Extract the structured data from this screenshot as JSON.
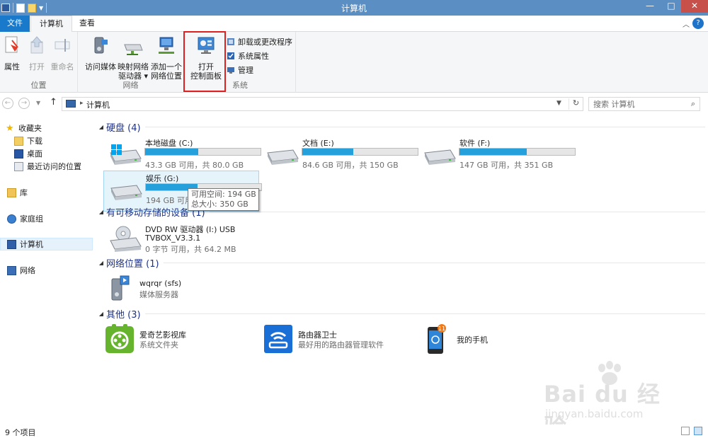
{
  "window": {
    "title": "计算机",
    "controls": [
      "—",
      "□",
      "✕"
    ]
  },
  "tabs": {
    "file": "文件",
    "computer": "计算机",
    "view": "查看"
  },
  "ribbon": {
    "location_group": "位置",
    "properties": "属性",
    "open": "打开",
    "rename": "重命名",
    "network_group": "网络",
    "access_media": "访问媒体",
    "map_drive_line1": "映射网络",
    "map_drive_line2": "驱动器",
    "add_location_line1": "添加一个",
    "add_location_line2": "网络位置",
    "open_cp_line1": "打开",
    "open_cp_line2": "控制面板",
    "system_group": "系统",
    "uninstall": "卸载或更改程序",
    "sys_props": "系统属性",
    "manage": "管理"
  },
  "address": {
    "breadcrumb": "计算机",
    "search_placeholder": "搜索 计算机"
  },
  "nav": {
    "favorites": "收藏夹",
    "downloads": "下载",
    "desktop": "桌面",
    "recent": "最近访问的位置",
    "libraries": "库",
    "homegroup": "家庭组",
    "computer": "计算机",
    "network": "网络"
  },
  "groups": {
    "hard_disks": "硬盘 (4)",
    "removable": "有可移动存储的设备 (1)",
    "network_locations": "网络位置 (1)",
    "others": "其他 (3)"
  },
  "drives": [
    {
      "name": "本地磁盘 (C:)",
      "detail": "43.3 GB 可用，共 80.0 GB",
      "used_fraction": 0.46
    },
    {
      "name": "文档 (E:)",
      "detail": "84.6 GB 可用，共 150 GB",
      "used_fraction": 0.44
    },
    {
      "name": "软件 (F:)",
      "detail": "147 GB 可用，共 351 GB",
      "used_fraction": 0.58
    },
    {
      "name": "娱乐 (G:)",
      "detail": "194 GB 可用，",
      "used_fraction": 0.45
    }
  ],
  "tooltip": {
    "free": "可用空间: 194 GB",
    "total": "总大小: 350 GB"
  },
  "dvd": {
    "name_line1": "DVD RW 驱动器 (I:) USB",
    "name_line2": "TVBOX_V3.3.1",
    "detail": "0 字节 可用，共 64.2 MB"
  },
  "network_item": {
    "name": "wqrqr (sfs)",
    "detail": "媒体服务器"
  },
  "other_items": [
    {
      "name": "爱奇艺影视库",
      "detail": "系统文件夹"
    },
    {
      "name": "路由器卫士",
      "detail": "最好用的路由器管理软件"
    },
    {
      "name": "我的手机",
      "detail": ""
    }
  ],
  "phone_badge": "11",
  "status": {
    "count": "9 个项目"
  },
  "watermark": {
    "main": "Bai du 经验",
    "sub": "jingyan.baidu.com"
  },
  "colors": {
    "title_bar": "#5b8ec3",
    "file_tab": "#1979ca",
    "usage_bar": "#26a0da",
    "group_header": "#1e3287",
    "highlight": "#e02020"
  }
}
